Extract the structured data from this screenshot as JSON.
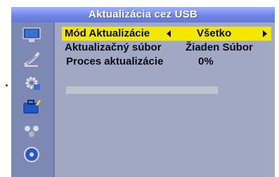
{
  "header": {
    "title": "Aktualizácia cez USB"
  },
  "sidebar": {
    "icons": [
      "monitor-icon",
      "satellite-dish-icon",
      "settings-gear-icon",
      "toolbox-icon",
      "network-icon",
      "media-disc-icon"
    ]
  },
  "menu": {
    "mode": {
      "label": "Mód Aktualizácie",
      "value": "Všetko"
    },
    "file": {
      "label": "Aktualizačný súbor",
      "value": "Žiaden Súbor"
    },
    "progress": {
      "label": "Proces aktualizácie",
      "value": "0%",
      "fraction": 0
    }
  },
  "colors": {
    "background": "#a0a8c4",
    "sidebar": "#7d89b2",
    "title_bar": "#6f86e6",
    "highlight": "#f4e800",
    "text": "#0a0a14"
  }
}
